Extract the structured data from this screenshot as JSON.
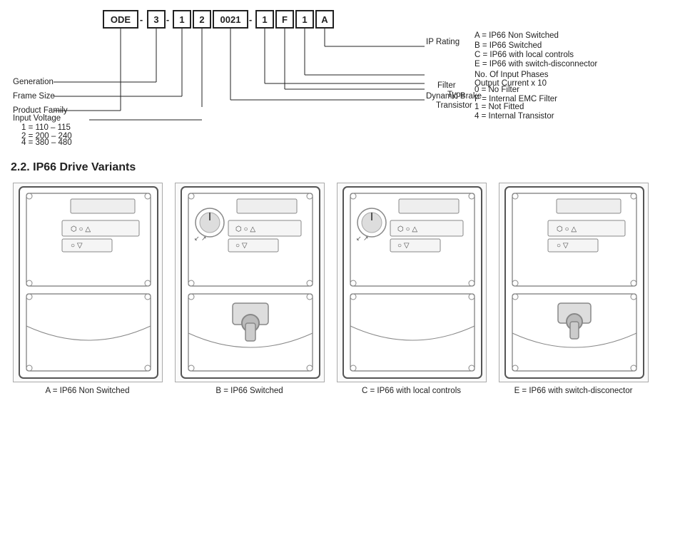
{
  "partNumber": {
    "boxes": [
      "ODE",
      "-",
      "3",
      "-",
      "1",
      "2",
      "0021",
      "-",
      "1",
      "F",
      "1",
      "A"
    ],
    "codeBoxes": [
      "ODE",
      "3",
      "1",
      "2",
      "0021",
      "1",
      "F",
      "1",
      "A"
    ],
    "separators": [
      "-",
      "-",
      "",
      "-",
      "",
      "",
      "-",
      ""
    ]
  },
  "diagram": {
    "leftLabels": [
      {
        "id": "product-family",
        "text": "Product Family",
        "topPct": 18
      },
      {
        "id": "generation",
        "text": "Generation",
        "topPct": 38
      },
      {
        "id": "frame-size",
        "text": "Frame Size",
        "topPct": 52
      },
      {
        "id": "input-voltage",
        "text": "Input Voltage",
        "topPct": 67
      }
    ],
    "inputVoltageValues": [
      "1 = 110 – 115",
      "2 = 200 – 240",
      "4 = 380 – 480"
    ],
    "rightLabels": [
      {
        "id": "ip-rating",
        "label": "IP Rating",
        "values": [
          "A = IP66 Non Switched",
          "B = IP66 Switched",
          "C = IP66 with local controls",
          "E = IP66 with switch-disconnector"
        ]
      },
      {
        "id": "dynamic-brake",
        "label": "Dynamic Brake",
        "sublabel": "Transistor",
        "values": [
          "1 = Not Fitted",
          "4 = Internal Transistor"
        ]
      },
      {
        "id": "filter-type",
        "label": "Filter",
        "sublabel": "Type",
        "values": [
          "0 = No Filter",
          "F = Internal EMC Filter"
        ]
      },
      {
        "id": "no-input-phases",
        "label": "No. Of Input Phases",
        "values": []
      },
      {
        "id": "output-current",
        "label": "Output Current x 10",
        "values": []
      }
    ]
  },
  "section22": {
    "title": "2.2. IP66 Drive Variants"
  },
  "variants": [
    {
      "id": "variant-a",
      "label": "A = IP66 Non Switched",
      "type": "non-switched"
    },
    {
      "id": "variant-b",
      "label": "B = IP66 Switched",
      "type": "switched"
    },
    {
      "id": "variant-c",
      "label": "C = IP66 with local controls",
      "type": "local-controls"
    },
    {
      "id": "variant-e",
      "label": "E = IP66 with switch-disconector",
      "type": "switch-disconnector"
    }
  ]
}
